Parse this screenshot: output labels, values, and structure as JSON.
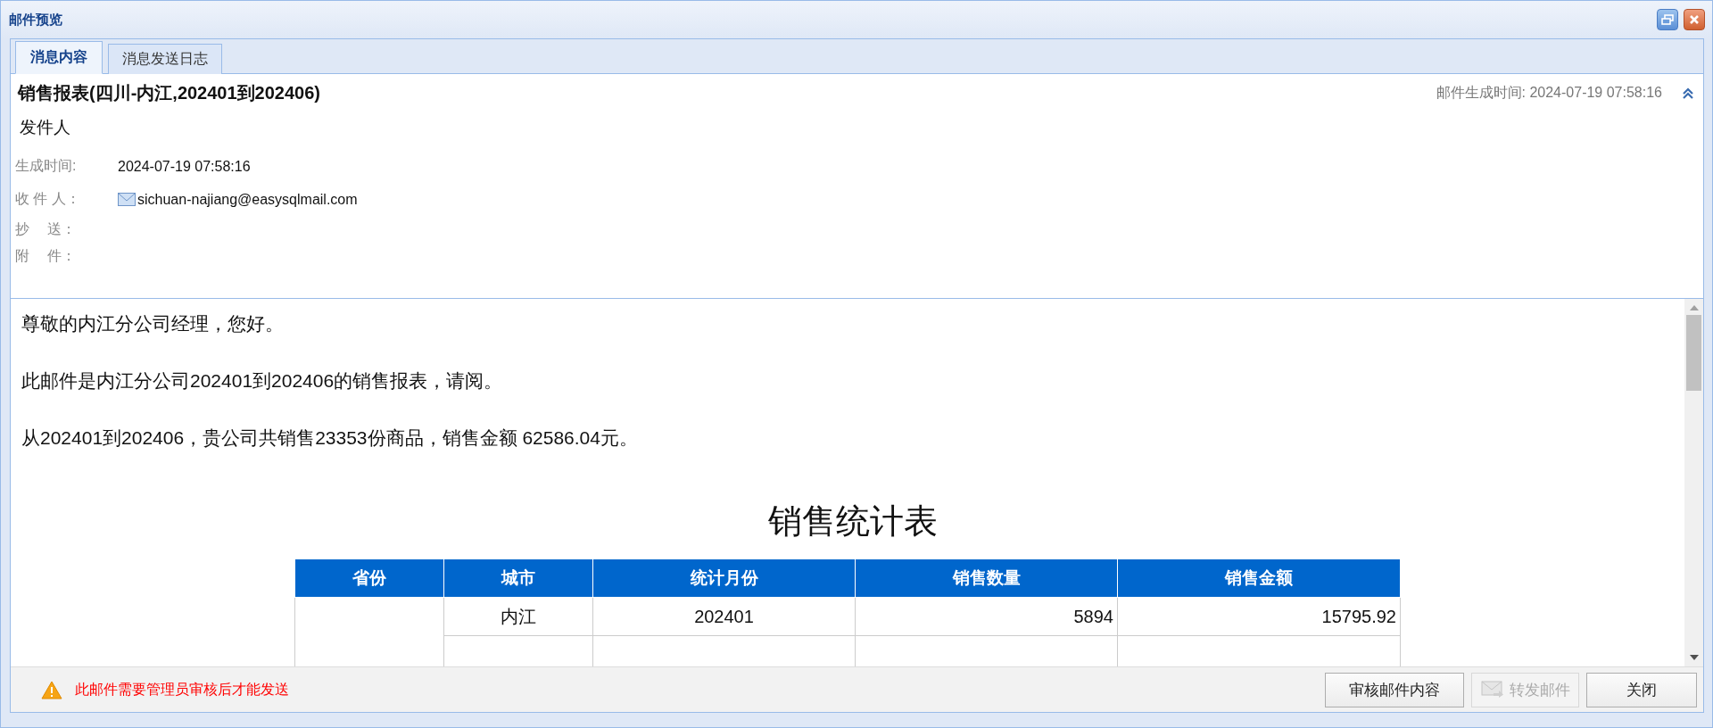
{
  "window": {
    "title": "邮件预览"
  },
  "tabs": [
    {
      "label": "消息内容",
      "selected": true
    },
    {
      "label": "消息发送日志",
      "selected": false
    }
  ],
  "message": {
    "subject": "销售报表(四川-内江,202401到202406)",
    "generated_stamp": "邮件生成时间: 2024-07-19 07:58:16",
    "sender_label": "发件人",
    "fields": [
      {
        "label": "生成时间:",
        "value": "2024-07-19 07:58:16",
        "kind": "text"
      },
      {
        "label": "收 件 人：",
        "value": "sichuan-najiang@easysqlmail.com",
        "kind": "email"
      },
      {
        "label": "抄　 送："
      },
      {
        "label": "附　 件："
      }
    ]
  },
  "body": {
    "paragraphs": [
      "尊敬的内江分公司经理，您好。",
      "此邮件是内江分公司202401到202406的销售报表，请阅。",
      "从202401到202406，贵公司共销售23353份商品，销售金额 62586.04元。"
    ],
    "table_title": "销售统计表",
    "table": {
      "columns": [
        "省份",
        "城市",
        "统计月份",
        "销售数量",
        "销售金额"
      ],
      "rows": [
        {
          "city": "内江",
          "month": "202401",
          "quantity": "5894",
          "amount": "15795.92"
        }
      ]
    }
  },
  "footer": {
    "warning": "此邮件需要管理员审核后才能发送",
    "buttons": [
      {
        "label": "审核邮件内容",
        "kind": "review",
        "disabled": false
      },
      {
        "label": "转发邮件",
        "kind": "forward",
        "disabled": true
      },
      {
        "label": "关闭",
        "kind": "close",
        "disabled": false
      }
    ]
  }
}
